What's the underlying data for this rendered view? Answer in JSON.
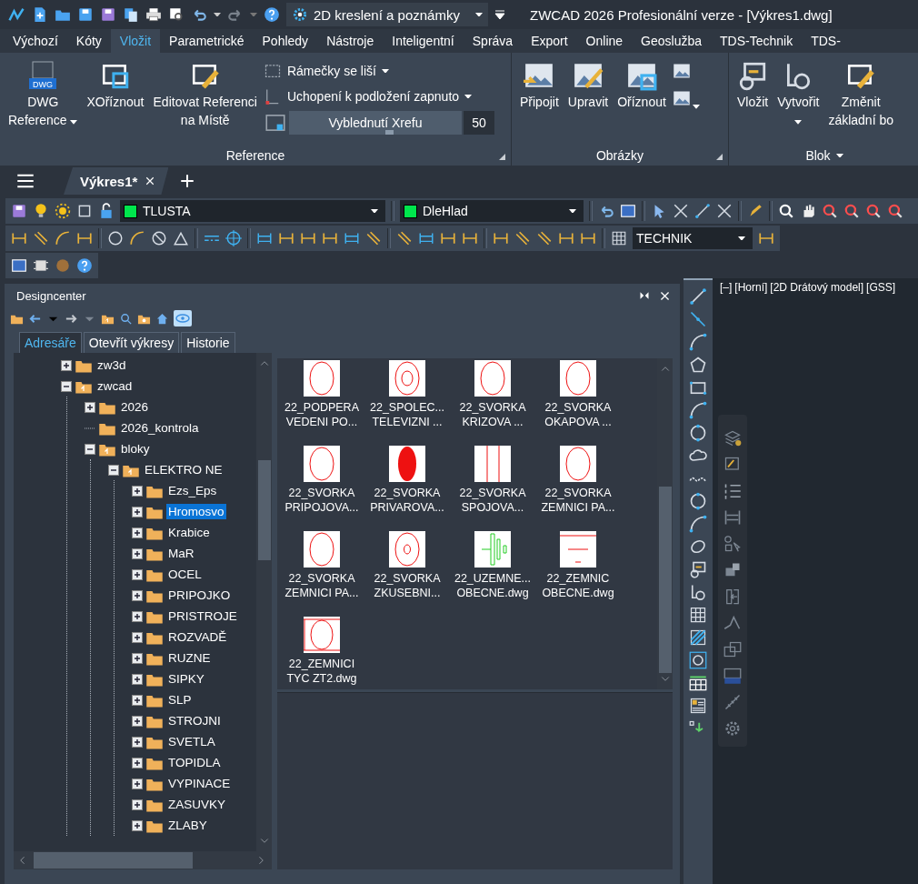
{
  "title_bar": {
    "workspace": "2D kreslení a poznámky",
    "title": "ZWCAD 2026 Profesionální verze - [Výkres1.dwg]"
  },
  "menu_tabs": [
    {
      "label": "Výchozí",
      "selected": false
    },
    {
      "label": "Kóty",
      "selected": false
    },
    {
      "label": "Vložit",
      "selected": true
    },
    {
      "label": "Parametrické",
      "selected": false
    },
    {
      "label": "Pohledy",
      "selected": false
    },
    {
      "label": "Nástroje",
      "selected": false
    },
    {
      "label": "Inteligentní",
      "selected": false
    },
    {
      "label": "Správa",
      "selected": false
    },
    {
      "label": "Export",
      "selected": false
    },
    {
      "label": "Online",
      "selected": false
    },
    {
      "label": "Geoslužba",
      "selected": false
    },
    {
      "label": "TDS-Technik",
      "selected": false
    },
    {
      "label": "TDS-",
      "selected": false
    }
  ],
  "ribbon": {
    "panels": [
      {
        "kind": "reference",
        "title": "Reference",
        "launcher": true,
        "menu": false,
        "large_buttons": [
          {
            "lines": [
              "DWG",
              "Reference"
            ],
            "icon_text": "DWG",
            "dropdown": true
          },
          {
            "lines": [
              "XOříznout"
            ],
            "dropdown": false
          },
          {
            "lines": [
              "Editovat Referenci",
              "na Místě"
            ],
            "dropdown": false
          }
        ],
        "small_buttons": [
          {
            "label": "Rámečky se liší",
            "dropdown": true
          },
          {
            "label": "Uchopení k podložení zapnuto",
            "dropdown": true
          }
        ],
        "fade": {
          "label": "Vyblednutí Xrefu",
          "level": 0.56,
          "value": "50"
        }
      },
      {
        "kind": "images",
        "title": "Obrázky",
        "launcher": true,
        "menu": false,
        "large_buttons": [
          {
            "lines": [
              "Připojit"
            ],
            "dropdown": false
          },
          {
            "lines": [
              "Upravit"
            ],
            "dropdown": false
          },
          {
            "lines": [
              "Oříznout"
            ],
            "dropdown": false
          }
        ]
      },
      {
        "kind": "block",
        "title": "Blok",
        "launcher": false,
        "menu": true,
        "large_buttons": [
          {
            "lines": [
              "Vložit"
            ],
            "dropdown": false
          },
          {
            "lines": [
              "Vytvořit"
            ],
            "dropdown": true
          },
          {
            "lines": [
              "Změnit",
              "základní bo"
            ],
            "dropdown": false
          }
        ]
      }
    ]
  },
  "doc_tabs": [
    {
      "label": "Výkres1*",
      "selected": true
    }
  ],
  "toolbars": {
    "layer": {
      "name": "TLUSTA",
      "color": "#00e64d"
    },
    "linetype": {
      "name": "DleHlad",
      "color": "#00e64d"
    },
    "dim_style": "TECHNIK"
  },
  "designcenter": {
    "title": "Designcenter",
    "tabs": [
      {
        "label": "Adresáře",
        "selected": true
      },
      {
        "label": "Otevřít výkresy",
        "selected": false
      },
      {
        "label": "Historie",
        "selected": false
      }
    ],
    "tree": [
      {
        "label": "zw3d",
        "expandable": true,
        "expanded": false,
        "selected": false
      },
      {
        "label": "zwcad",
        "expandable": true,
        "expanded": true,
        "selected": false,
        "children": [
          {
            "label": "2026",
            "expandable": true,
            "expanded": false,
            "selected": false
          },
          {
            "label": "2026_kontrola",
            "expandable": false,
            "selected": false
          },
          {
            "label": "bloky",
            "expandable": true,
            "expanded": true,
            "selected": false,
            "children": [
              {
                "label": "ELEKTRO NE",
                "expandable": true,
                "expanded": true,
                "selected": false,
                "children": [
                  {
                    "label": "Ezs_Eps",
                    "expandable": true,
                    "expanded": false,
                    "selected": false
                  },
                  {
                    "label": "Hromosvo",
                    "expandable": true,
                    "expanded": false,
                    "selected": true
                  },
                  {
                    "label": "Krabice",
                    "expandable": true,
                    "expanded": false,
                    "selected": false
                  },
                  {
                    "label": "MaR",
                    "expandable": true,
                    "expanded": false,
                    "selected": false
                  },
                  {
                    "label": "OCEL",
                    "expandable": true,
                    "expanded": false,
                    "selected": false
                  },
                  {
                    "label": "PRIPOJKO",
                    "expandable": true,
                    "expanded": false,
                    "selected": false
                  },
                  {
                    "label": "PRISTROJE",
                    "expandable": true,
                    "expanded": false,
                    "selected": false
                  },
                  {
                    "label": "ROZVADĚ",
                    "expandable": true,
                    "expanded": false,
                    "selected": false
                  },
                  {
                    "label": "RUZNE",
                    "expandable": true,
                    "expanded": false,
                    "selected": false
                  },
                  {
                    "label": "SIPKY",
                    "expandable": true,
                    "expanded": false,
                    "selected": false
                  },
                  {
                    "label": "SLP",
                    "expandable": true,
                    "expanded": false,
                    "selected": false
                  },
                  {
                    "label": "STROJNI",
                    "expandable": true,
                    "expanded": false,
                    "selected": false
                  },
                  {
                    "label": "SVETLA",
                    "expandable": true,
                    "expanded": false,
                    "selected": false
                  },
                  {
                    "label": "TOPIDLA",
                    "expandable": true,
                    "expanded": false,
                    "selected": false
                  },
                  {
                    "label": "VYPINACE",
                    "expandable": true,
                    "expanded": false,
                    "selected": false
                  },
                  {
                    "label": "ZASUVKY",
                    "expandable": true,
                    "expanded": false,
                    "selected": false
                  },
                  {
                    "label": "ZLABY",
                    "expandable": true,
                    "expanded": false,
                    "selected": false
                  }
                ]
              }
            ]
          }
        ]
      }
    ],
    "items": [
      {
        "kind": "oval",
        "lines": [
          "22_PODPERA",
          "VEDENI PO..."
        ]
      },
      {
        "kind": "ring",
        "lines": [
          "22_SPOLEC...",
          "TELEVIZNI ..."
        ]
      },
      {
        "kind": "oval",
        "lines": [
          "22_SVORKA",
          "KRIZOVA ..."
        ]
      },
      {
        "kind": "oval",
        "lines": [
          "22_SVORKA",
          "OKAPOVA ..."
        ]
      },
      {
        "kind": "oval",
        "lines": [
          "22_SVORKA",
          "PRIPOJOVA..."
        ]
      },
      {
        "kind": "filled",
        "lines": [
          "22_SVORKA",
          "PRIVAROVA..."
        ]
      },
      {
        "kind": "double-line",
        "lines": [
          "22_SVORKA",
          "SPOJOVA..."
        ]
      },
      {
        "kind": "oval",
        "lines": [
          "22_SVORKA",
          "ZEMNICI PA..."
        ]
      },
      {
        "kind": "oval",
        "lines": [
          "22_SVORKA",
          "ZEMNICI PA..."
        ]
      },
      {
        "kind": "ring-small",
        "lines": [
          "22_SVORKA",
          "ZKUSEBNI..."
        ]
      },
      {
        "kind": "grounding-green",
        "lines": [
          "22_UZEMNE...",
          "OBECNE.dwg"
        ]
      },
      {
        "kind": "grounding-lines",
        "lines": [
          "22_ZEMNIC",
          "OBECNE.dwg"
        ]
      },
      {
        "kind": "framed-oval",
        "lines": [
          "22_ZEMNICI",
          "TYC ZT2.dwg"
        ]
      }
    ]
  },
  "viewport": {
    "labels": [
      "[–]",
      "[Horní]",
      "[2D Drátový model]",
      "[GSS]"
    ]
  }
}
